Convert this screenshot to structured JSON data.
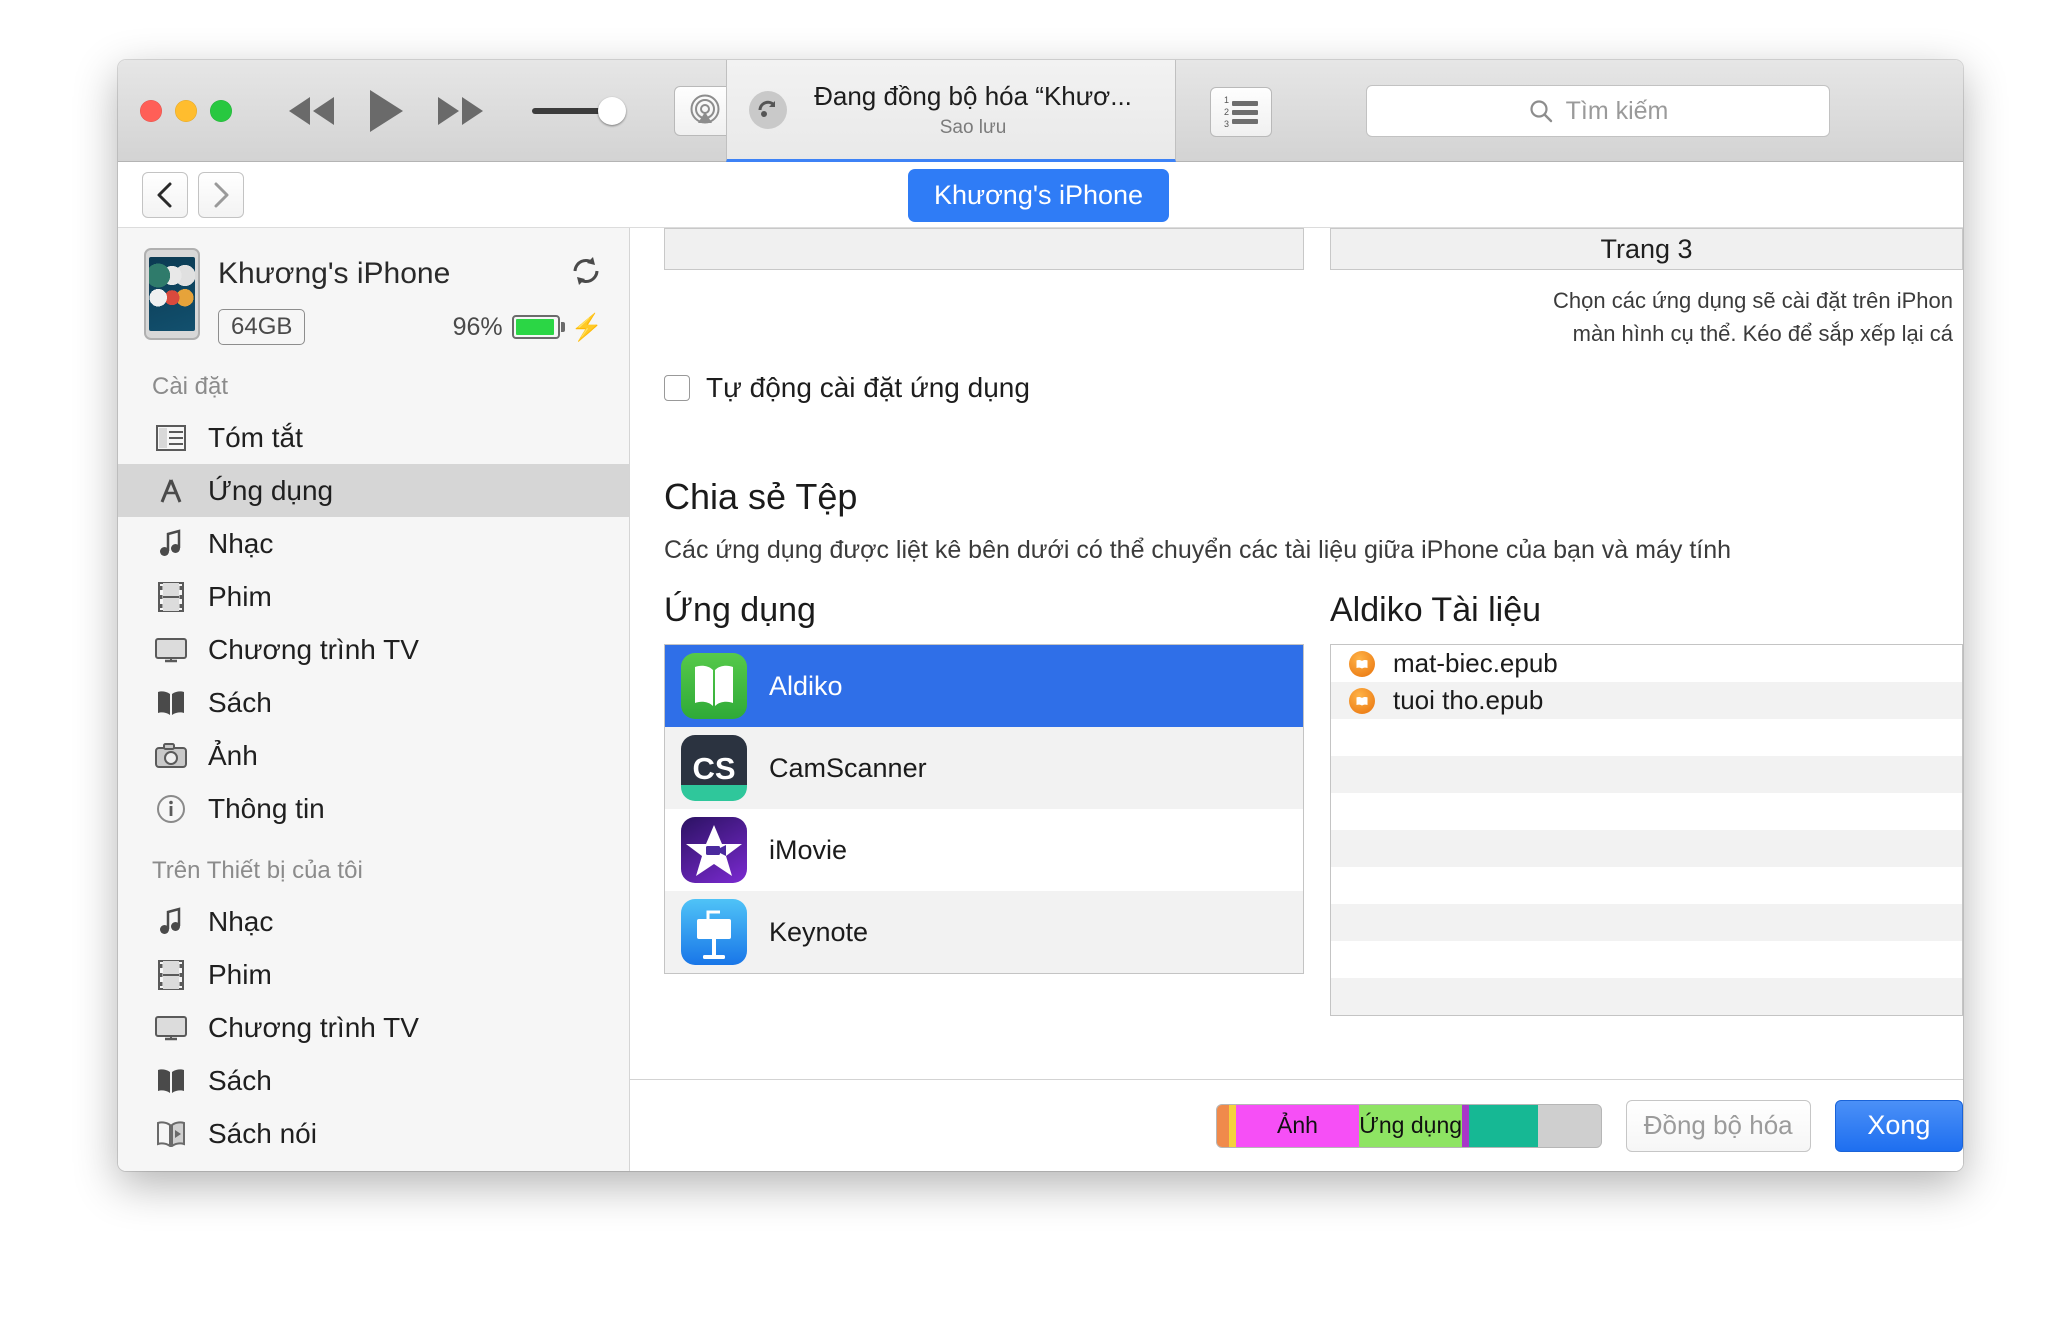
{
  "titlebar": {
    "window_controls": [
      "close",
      "minimize",
      "zoom"
    ],
    "transport": {
      "rewind": "rewind-icon",
      "play": "play-icon",
      "forward": "fast-forward-icon"
    },
    "volume_label": "volume-slider",
    "airplay_label": "airplay-icon",
    "status": {
      "main": "Đang đồng bộ hóa “Khươ...",
      "sub": "Sao lưu",
      "icon": "sync-icon"
    },
    "list_button": "numbered-list-icon",
    "search": {
      "placeholder": "Tìm kiếm",
      "value": "",
      "icon": "search-icon"
    }
  },
  "subbar": {
    "back": "‹",
    "forward": "›",
    "device_pill": "Khương's iPhone"
  },
  "sidebar": {
    "device": {
      "name": "Khương's iPhone",
      "capacity": "64GB",
      "battery_percent": "96%",
      "charging": true,
      "sync_icon": "refresh-icon"
    },
    "sections": [
      {
        "title": "Cài đặt",
        "items": [
          {
            "label": "Tóm tắt",
            "icon": "summary-icon",
            "active": false
          },
          {
            "label": "Ứng dụng",
            "icon": "apps-icon",
            "active": true
          },
          {
            "label": "Nhạc",
            "icon": "music-note-icon",
            "active": false
          },
          {
            "label": "Phim",
            "icon": "film-icon",
            "active": false
          },
          {
            "label": "Chương trình TV",
            "icon": "tv-icon",
            "active": false
          },
          {
            "label": "Sách",
            "icon": "book-icon",
            "active": false
          },
          {
            "label": "Ảnh",
            "icon": "camera-icon",
            "active": false
          },
          {
            "label": "Thông tin",
            "icon": "info-icon",
            "active": false
          }
        ]
      },
      {
        "title": "Trên Thiết bị của tôi",
        "items": [
          {
            "label": "Nhạc",
            "icon": "music-note-icon",
            "active": false
          },
          {
            "label": "Phim",
            "icon": "film-icon",
            "active": false
          },
          {
            "label": "Chương trình TV",
            "icon": "tv-icon",
            "active": false
          },
          {
            "label": "Sách",
            "icon": "book-icon",
            "active": false
          },
          {
            "label": "Sách nói",
            "icon": "audiobook-icon",
            "active": false
          }
        ]
      }
    ]
  },
  "main": {
    "page_panel": {
      "title": "Trang 3",
      "desc_line1": "Chọn các ứng dụng sẽ cài đặt trên iPhon",
      "desc_line2": "màn hình cụ thể. Kéo để sắp xếp lại cá"
    },
    "auto_install": {
      "label": "Tự động cài đặt ứng dụng",
      "checked": false
    },
    "file_sharing": {
      "title": "Chia sẻ Tệp",
      "description": "Các ứng dụng được liệt kê bên dưới có thể chuyển các tài liệu giữa iPhone của bạn và máy tính",
      "apps_header": "Ứng dụng",
      "docs_header": "Aldiko Tài liệu",
      "apps": [
        {
          "name": "Aldiko",
          "icon": "aldiko-book-icon",
          "selected": true
        },
        {
          "name": "CamScanner",
          "icon": "camscanner-icon",
          "selected": false
        },
        {
          "name": "iMovie",
          "icon": "imovie-star-icon",
          "selected": false
        },
        {
          "name": "Keynote",
          "icon": "keynote-podium-icon",
          "selected": false
        }
      ],
      "documents": [
        {
          "name": "mat-biec.epub",
          "icon": "epub-book-icon"
        },
        {
          "name": "tuoi tho.epub",
          "icon": "epub-book-icon"
        }
      ]
    }
  },
  "bottom": {
    "capacity_segments": [
      {
        "label": "",
        "color": "#f08a4b",
        "width_pct": 3.2
      },
      {
        "label": "",
        "color": "#f5d13c",
        "width_pct": 1.8
      },
      {
        "label": "Ảnh",
        "color": "#f64ff6",
        "width_pct": 32
      },
      {
        "label": "Ứng dụng",
        "color": "#8ee463",
        "width_pct": 27
      },
      {
        "label": "",
        "color": "#a838c8",
        "width_pct": 1.6
      },
      {
        "label": "",
        "color": "#16b894",
        "width_pct": 18
      },
      {
        "label": "",
        "color": "#cfcfcf",
        "width_pct": 16.4
      }
    ],
    "sync_button": "Đồng bộ hóa",
    "done_button": "Xong"
  },
  "colors": {
    "accent_blue": "#2f7cf6",
    "selection_blue": "#2f6fe8",
    "battery_green": "#2bd645"
  }
}
